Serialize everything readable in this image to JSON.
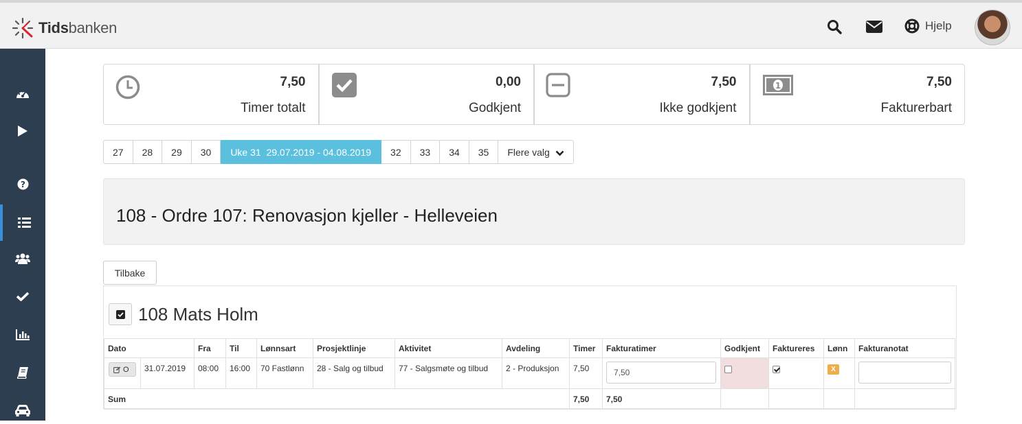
{
  "brand": {
    "name_bold": "Tids",
    "name_rest": "banken"
  },
  "topbar": {
    "help_label": "Hjelp"
  },
  "colors": {
    "sidebar": "#2c3e50",
    "accent": "#5bc0de",
    "active_indicator": "#3b8fd9",
    "warning": "#f0ad4e",
    "danger_bg": "#f2dede"
  },
  "sidebar": {
    "items": [
      {
        "icon": "dashboard-icon"
      },
      {
        "icon": "play-icon"
      },
      {
        "icon": "help-icon"
      },
      {
        "icon": "list-icon",
        "active": true
      },
      {
        "icon": "users-icon"
      },
      {
        "icon": "check-icon"
      },
      {
        "icon": "bar-chart-icon"
      },
      {
        "icon": "book-icon"
      },
      {
        "icon": "car-icon"
      }
    ]
  },
  "stats": [
    {
      "value": "7,50",
      "label": "Timer totalt",
      "icon": "clock-icon"
    },
    {
      "value": "0,00",
      "label": "Godkjent",
      "icon": "checkbox-checked-icon"
    },
    {
      "value": "7,50",
      "label": "Ikke godkjent",
      "icon": "minus-square-icon"
    },
    {
      "value": "7,50",
      "label": "Fakturerbart",
      "icon": "money-icon"
    }
  ],
  "weeks": {
    "before": [
      "27",
      "28",
      "29",
      "30"
    ],
    "active": "Uke 31  29.07.2019 - 04.08.2019",
    "after": [
      "32",
      "33",
      "34",
      "35"
    ],
    "more_label": "Flere valg"
  },
  "project": {
    "title": "108 - Ordre 107: Renovasjon kjeller - Helleveien"
  },
  "back_label": "Tilbake",
  "employee": {
    "name": "108 Mats Holm"
  },
  "table": {
    "headers": [
      "Dato",
      "Fra",
      "Til",
      "Lønnsart",
      "Prosjektlinje",
      "Aktivitet",
      "Avdeling",
      "Timer",
      "Fakturatimer",
      "Godkjent",
      "Faktureres",
      "Lønn",
      "Fakturanotat"
    ],
    "row": {
      "button_label": "O",
      "date": "31.07.2019",
      "from": "08:00",
      "to": "16:00",
      "wage_type": "70 Fastlønn",
      "project_line": "28 - Salg og tilbud",
      "activity": "77 - Salgsmøte og tilbud",
      "department": "2 - Produksjon",
      "hours": "7,50",
      "invoice_hours": "7,50",
      "approved": false,
      "invoiced": true,
      "salary_badge": "X",
      "invoice_note": ""
    },
    "sum": {
      "label": "Sum",
      "hours": "7,50",
      "invoice_hours": "7,50"
    }
  }
}
